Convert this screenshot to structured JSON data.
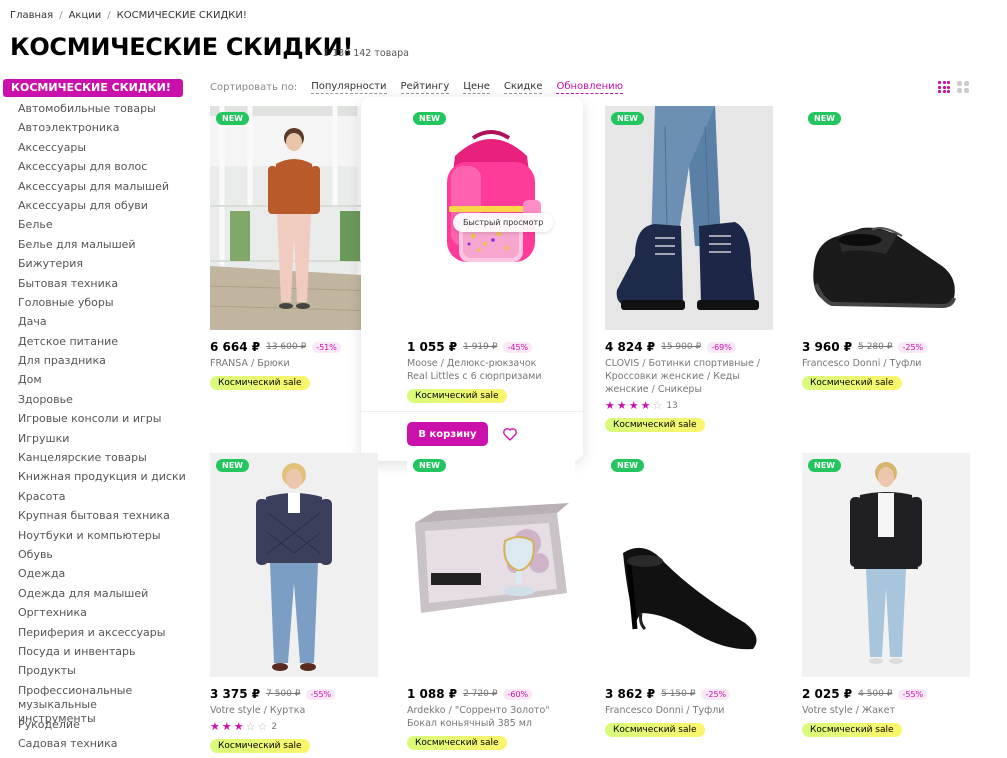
{
  "breadcrumb": [
    "Главная",
    "Акции",
    "КОСМИЧЕСКИЕ СКИДКИ!"
  ],
  "title": "КОСМИЧЕСКИЕ СКИДКИ!",
  "count": "1 130 142 товара",
  "sidebar": {
    "active": "КОСМИЧЕСКИЕ СКИДКИ!",
    "items": [
      "Автомобильные товары",
      "Автоэлектроника",
      "Аксессуары",
      "Аксессуары для волос",
      "Аксессуары для малышей",
      "Аксессуары для обуви",
      "Белье",
      "Белье для малышей",
      "Бижутерия",
      "Бытовая техника",
      "Головные уборы",
      "Дача",
      "Детское питание",
      "Для праздника",
      "Дом",
      "Здоровье",
      "Игровые консоли и игры",
      "Игрушки",
      "Канцелярские товары",
      "Книжная продукция и диски",
      "Красота",
      "Крупная бытовая техника",
      "Ноутбуки и компьютеры",
      "Обувь",
      "Одежда",
      "Одежда для малышей",
      "Оргтехника",
      "Периферия и аксессуары",
      "Посуда и инвентарь",
      "Продукты",
      "Профессиональные музыкальные инструменты",
      "Рукоделие",
      "Садовая техника"
    ]
  },
  "sort": {
    "label": "Сортировать по:",
    "options": [
      "Популярности",
      "Рейтингу",
      "Цене",
      "Скидке",
      "Обновлению"
    ],
    "selected": "Обновлению"
  },
  "badge_new": "NEW",
  "sale_label": "Космический sale",
  "quick_view": "Быстрый просмотр",
  "cart_button": "В корзину",
  "colors": {
    "accent": "#cb11ab",
    "new": "#22c55e",
    "sale_from": "#d9fb7a",
    "sale_to": "#fcf56c"
  },
  "products": [
    {
      "price": "6 664 ₽",
      "old": "13 600 ₽",
      "disc": "-51%",
      "brand": "FRANSA / Брюки",
      "image": "woman-orange-sweater"
    },
    {
      "price": "1 055 ₽",
      "old": "1 919 ₽",
      "disc": "-45%",
      "brand": "Moose / Делюкс-рюкзачок Real Littles с 6 сюрпризами",
      "image": "pink-backpack"
    },
    {
      "price": "4 824 ₽",
      "old": "15 900 ₽",
      "disc": "-69%",
      "brand": "CLOVIS / Ботинки спортивные / Кроссовки женские / Кеды женские / Сникеры",
      "image": "navy-boots",
      "rating": 4,
      "reviews": "13"
    },
    {
      "price": "3 960 ₽",
      "old": "5 280 ₽",
      "disc": "-25%",
      "brand": "Francesco Donni / Туфли",
      "image": "black-loafer"
    },
    {
      "price": "3 375 ₽",
      "old": "7 500 ₽",
      "disc": "-55%",
      "brand": "Votre style / Куртка",
      "image": "woman-quilted-jacket",
      "rating": 3,
      "reviews": "2"
    },
    {
      "price": "1 088 ₽",
      "old": "2 720 ₽",
      "disc": "-60%",
      "brand": "Ardekko / \"Сорренто Золото\" Бокал коньячный 385 мл",
      "image": "glass-in-box"
    },
    {
      "price": "3 862 ₽",
      "old": "5 150 ₽",
      "disc": "-25%",
      "brand": "Francesco Donni / Туфли",
      "image": "black-pumps"
    },
    {
      "price": "2 025 ₽",
      "old": "4 500 ₽",
      "disc": "-55%",
      "brand": "Votre style / Жакет",
      "image": "woman-black-blazer"
    }
  ]
}
